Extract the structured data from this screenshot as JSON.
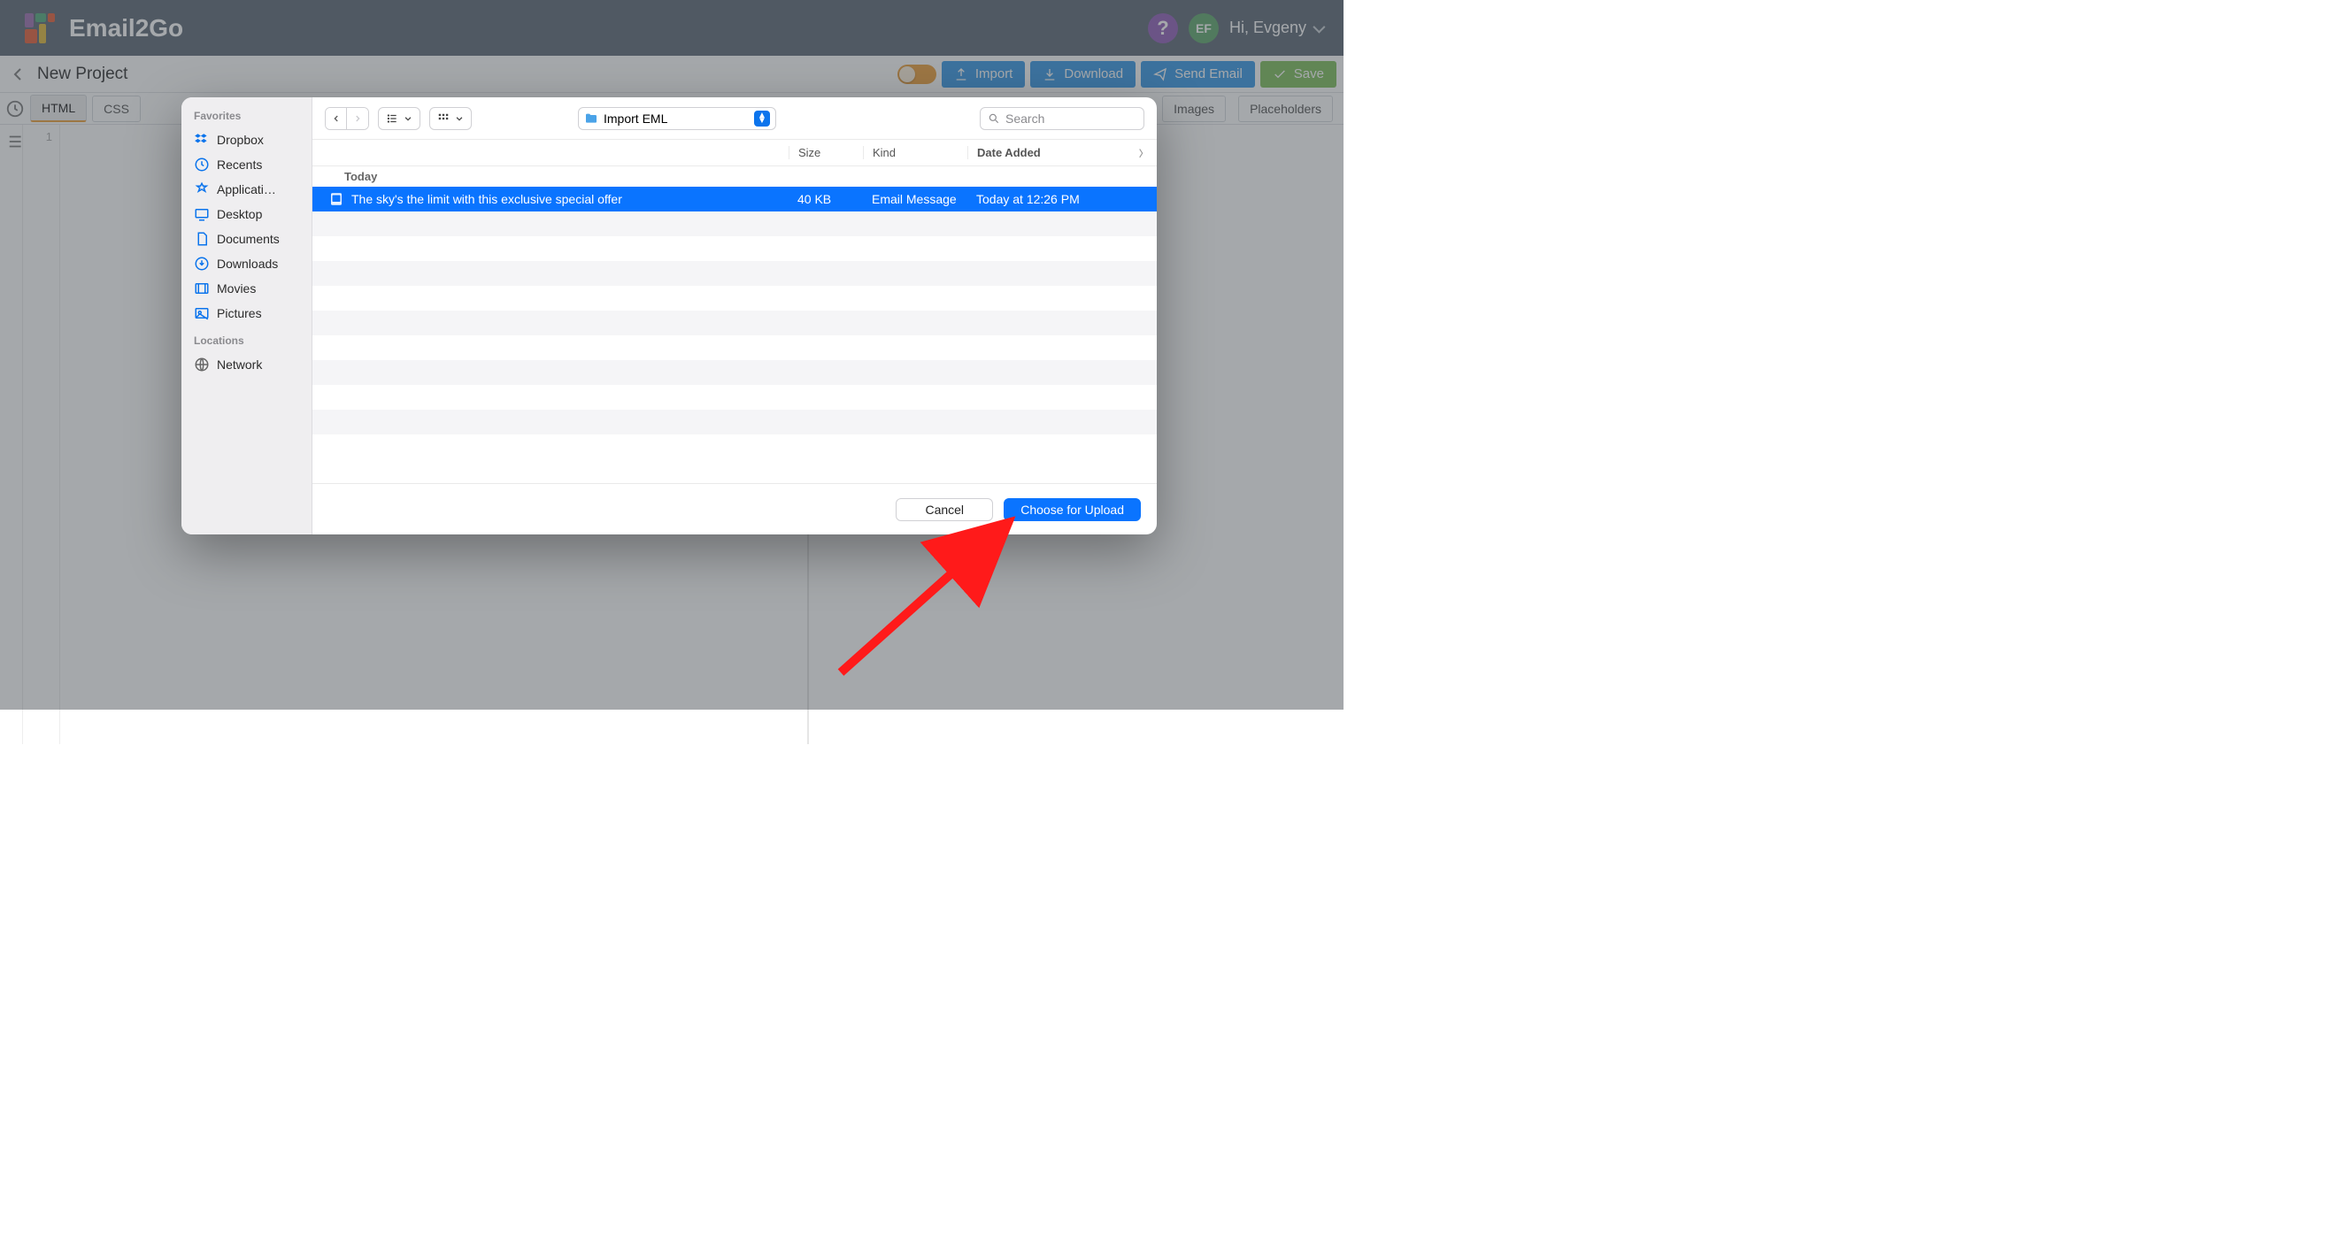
{
  "header": {
    "brand": "Email2Go",
    "help": "?",
    "avatar_initials": "EF",
    "greeting": "Hi, Evgeny"
  },
  "projectbar": {
    "title": "New Project",
    "buttons": {
      "import": "Import",
      "download": "Download",
      "send": "Send Email",
      "save": "Save"
    }
  },
  "tabs": {
    "html": "HTML",
    "css": "CSS",
    "images": "Images",
    "placeholders": "Placeholders"
  },
  "gutter": {
    "line1": "1"
  },
  "dialog": {
    "sidebar": {
      "favorites_header": "Favorites",
      "items": [
        "Dropbox",
        "Recents",
        "Applicati…",
        "Desktop",
        "Documents",
        "Downloads",
        "Movies",
        "Pictures"
      ],
      "locations_header": "Locations",
      "locations": [
        "Network"
      ]
    },
    "location_label": "Import EML",
    "search_placeholder": "Search",
    "columns": {
      "name": "Today",
      "size": "Size",
      "kind": "Kind",
      "date": "Date Added"
    },
    "row": {
      "name": "The sky's the limit with this exclusive special offer",
      "size": "40 KB",
      "kind": "Email Message",
      "date": "Today at 12:26 PM"
    },
    "cancel": "Cancel",
    "choose": "Choose for Upload"
  }
}
